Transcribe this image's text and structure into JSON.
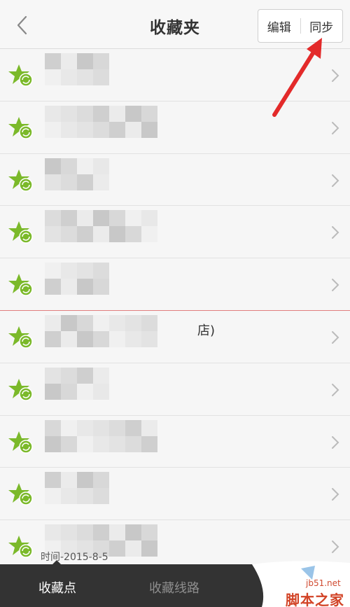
{
  "header": {
    "back_label": "<",
    "title": "收藏夹",
    "edit_label": "编辑",
    "sync_label": "同步"
  },
  "rows": [
    {
      "top": "",
      "bottom": ""
    },
    {
      "top": "",
      "bottom": ""
    },
    {
      "top": "",
      "bottom": ""
    },
    {
      "top": "",
      "bottom": ""
    },
    {
      "top": "",
      "bottom": ""
    },
    {
      "top": "",
      "bottom": "",
      "tail": "店)"
    },
    {
      "top": "",
      "bottom": ""
    },
    {
      "top": "",
      "bottom": ""
    },
    {
      "top": "",
      "bottom": ""
    },
    {
      "top": "",
      "bottom": "",
      "date": "时间-2015-8-5"
    }
  ],
  "tabs": {
    "favorites_points": "收藏点",
    "favorites_routes": "收藏线路"
  },
  "watermark": {
    "site": "jb51.net",
    "name": "脚本之家"
  },
  "colors": {
    "star": "#7bb92a",
    "arrow": "#e32a2a",
    "tabbar": "#333333",
    "highlight_line": "#e07d7d"
  },
  "icons": {
    "back": "chevron-left-icon",
    "row": "star-sync-icon",
    "row_arrow": "chevron-right-icon"
  }
}
